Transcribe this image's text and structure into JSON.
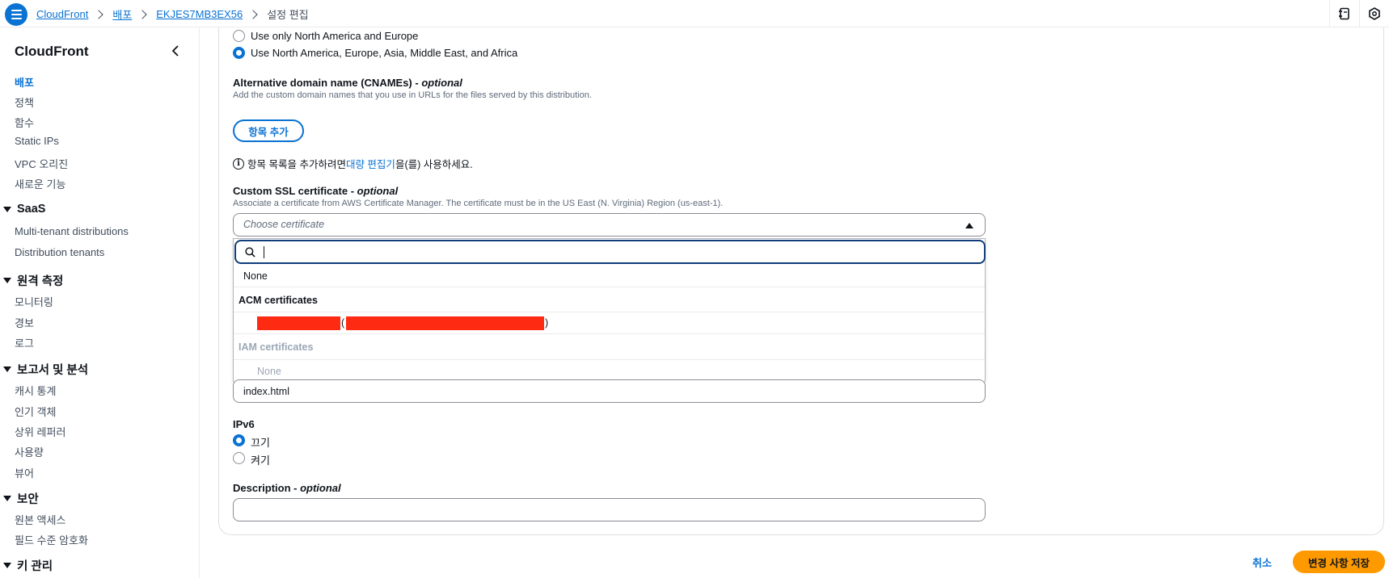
{
  "topbar": {
    "breadcrumbs": [
      "CloudFront",
      "배포",
      "EKJES7MB3EX56"
    ],
    "current": "설정 편집"
  },
  "sidebar": {
    "title": "CloudFront",
    "items_top": [
      "배포",
      "정책",
      "함수",
      "Static IPs",
      "VPC 오리진",
      "새로운 기능"
    ],
    "sections": [
      {
        "title": "SaaS",
        "items": [
          "Multi-tenant distributions",
          "Distribution tenants"
        ]
      },
      {
        "title": "원격 측정",
        "items": [
          "모니터링",
          "경보",
          "로그"
        ]
      },
      {
        "title": "보고서 및 분석",
        "items": [
          "캐시 통계",
          "인기 객체",
          "상위 레퍼러",
          "사용량",
          "뷰어"
        ]
      },
      {
        "title": "보안",
        "items": [
          "원본 액세스",
          "필드 수준 암호화"
        ]
      },
      {
        "title": "키 관리",
        "items": []
      }
    ]
  },
  "price_class": {
    "option1": "Use only North America and Europe",
    "option2": "Use North America, Europe, Asia, Middle East, and Africa"
  },
  "cname": {
    "label": "Alternative domain name (CNAMEs)",
    "optional": "optional",
    "description": "Add the custom domain names that you use in URLs for the files served by this distribution.",
    "add_button": "항목 추가",
    "info_prefix": "항목 목록을 추가하려면 ",
    "info_link": "대량 편집기",
    "info_suffix": "을(를) 사용하세요."
  },
  "ssl": {
    "label": "Custom SSL certificate",
    "optional": "optional",
    "description": "Associate a certificate from AWS Certificate Manager. The certificate must be in the US East (N. Virginia) Region (us-east-1).",
    "placeholder": "Choose certificate",
    "dropdown": {
      "none_option": "None",
      "acm_group": "ACM certificates",
      "acm_paren_open": "(",
      "acm_paren_close": ")",
      "iam_group": "IAM certificates",
      "iam_none": "None"
    }
  },
  "default_root": {
    "value": "index.html"
  },
  "ipv6": {
    "label": "IPv6",
    "off": "끄기",
    "on": "켜기"
  },
  "description_field": {
    "label": "Description",
    "optional": "optional"
  },
  "footer": {
    "cancel": "취소",
    "save": "변경 사항 저장"
  },
  "colors": {
    "accent": "#0972d3",
    "primary_button": "#ff9900",
    "redaction": "#ff2a12"
  }
}
